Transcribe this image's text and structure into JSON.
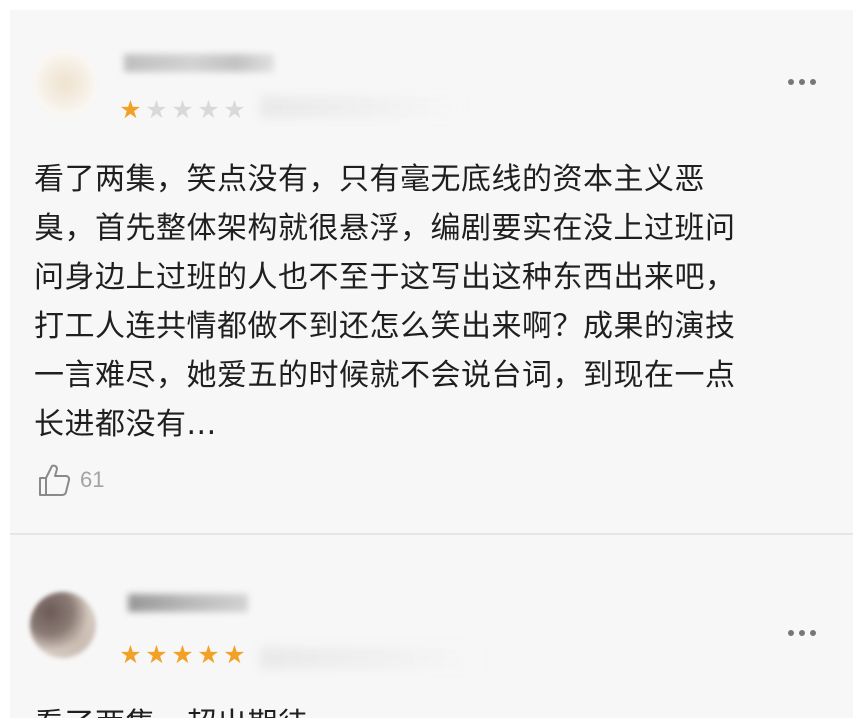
{
  "reviews": [
    {
      "rating_filled": 1,
      "rating_total": 5,
      "text_lines": [
        "看了两集，笑点没有，只有毫无底线的资本主义恶",
        "臭，首先整体架构就很悬浮，编剧要实在没上过班问",
        "问身边上过班的人也不至于这写出这种东西出来吧，",
        "打工人连共情都做不到还怎么笑出来啊？成果的演技",
        "一言难尽，她爱五的时候就不会说台词，到现在一点",
        "长进都没有..."
      ],
      "likes": "61",
      "icons": {
        "like": "thumbs-up-icon",
        "more": "more-dots-icon"
      }
    },
    {
      "rating_filled": 5,
      "rating_total": 5,
      "text_partial": "看了两集，超出期待",
      "icons": {
        "more": "more-dots-icon"
      }
    }
  ],
  "colors": {
    "star_filled": "#f2a126",
    "star_empty": "#d9d9d9",
    "text": "#1f1f1f",
    "muted": "#a3a3a3",
    "background": "#f7f7f7"
  }
}
